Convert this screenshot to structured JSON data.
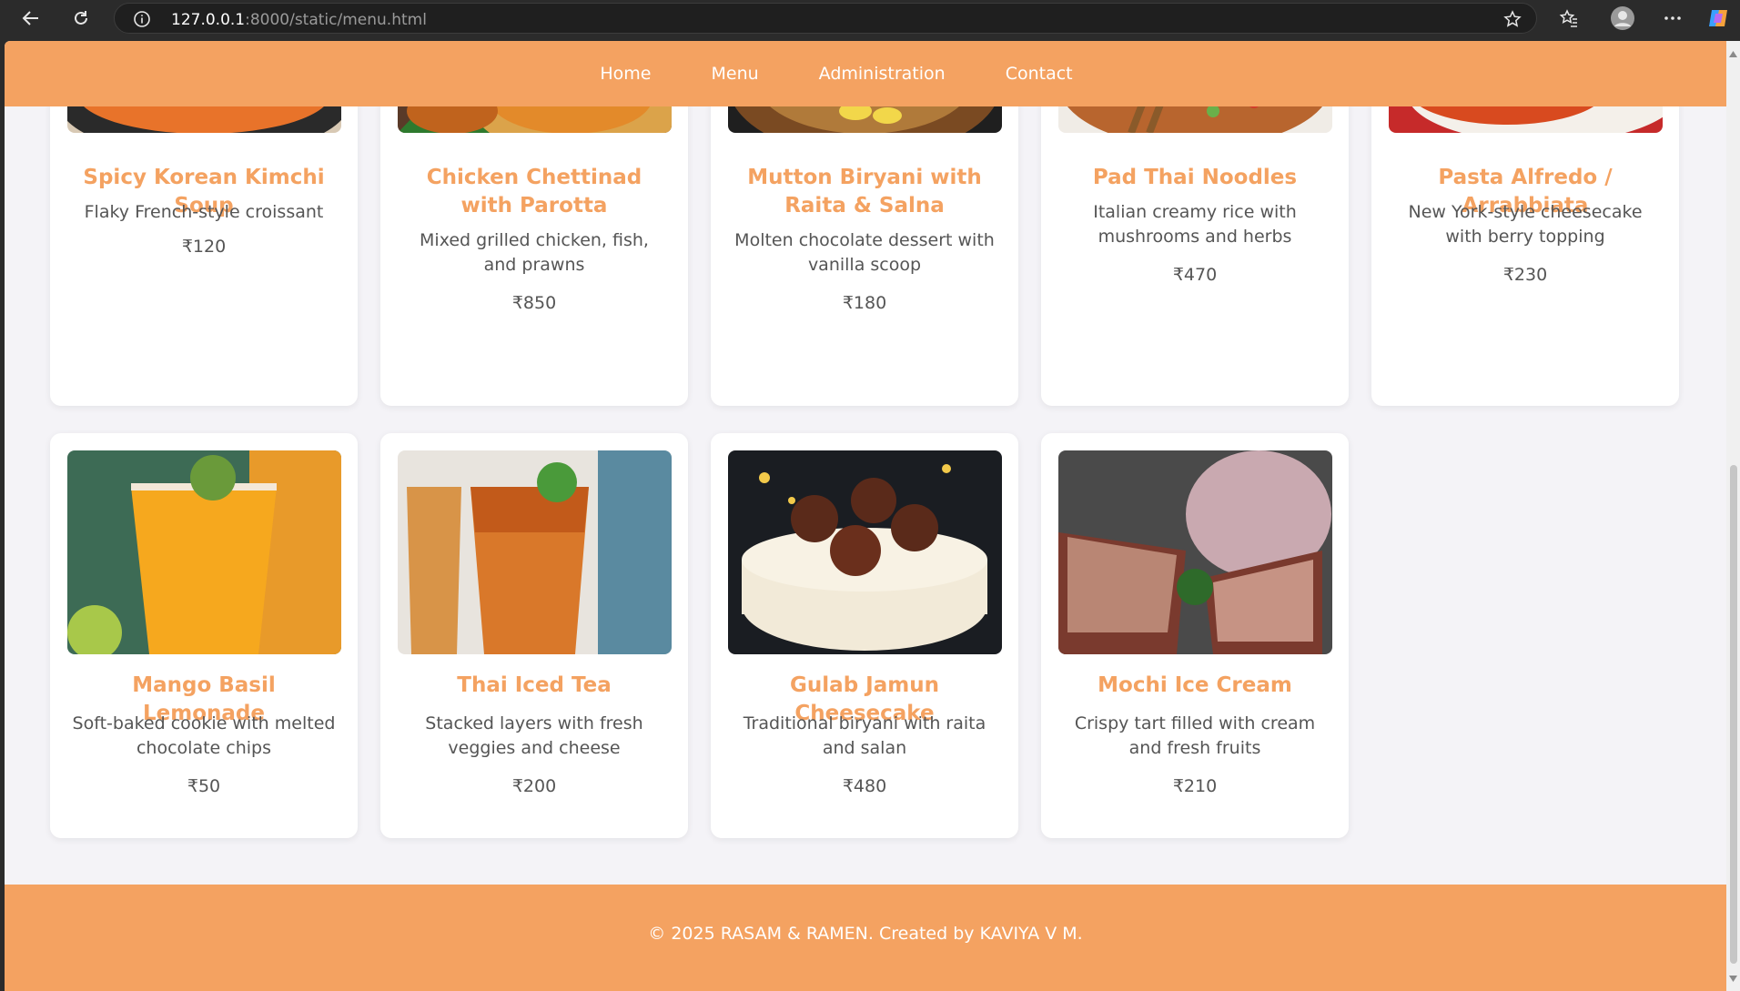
{
  "browser": {
    "url_host": "127.0.0.1",
    "url_rest": ":8000/static/menu.html"
  },
  "nav": {
    "items": [
      "Home",
      "Menu",
      "Administration",
      "Contact"
    ]
  },
  "menu_items": [
    {
      "title": "Spicy Korean Kimchi Soup",
      "desc": "Flaky French-style croissant",
      "price": "₹120"
    },
    {
      "title": "Chicken Chettinad with Parotta",
      "desc": "Mixed grilled chicken, fish, and prawns",
      "price": "₹850"
    },
    {
      "title": "Mutton Biryani with Raita & Salna",
      "desc": "Molten chocolate dessert with vanilla scoop",
      "price": "₹180"
    },
    {
      "title": "Pad Thai Noodles",
      "desc": "Italian creamy rice with mushrooms and herbs",
      "price": "₹470"
    },
    {
      "title": "Pasta Alfredo / Arrabbiata",
      "desc": "New York-style cheesecake with berry topping",
      "price": "₹230"
    },
    {
      "title": "Mango Basil Lemonade",
      "desc": "Soft-baked cookie with melted chocolate chips",
      "price": "₹50"
    },
    {
      "title": "Thai Iced Tea",
      "desc": "Stacked layers with fresh veggies and cheese",
      "price": "₹200"
    },
    {
      "title": "Gulab Jamun Cheesecake",
      "desc": "Traditional biryani with raita and salan",
      "price": "₹480"
    },
    {
      "title": "Mochi Ice Cream",
      "desc": "Crispy tart filled with cream and fresh fruits",
      "price": "₹210"
    }
  ],
  "footer": {
    "text": "© 2025 RASAM & RAMEN. Created by KAVIYA V M."
  },
  "colors": {
    "brand": "#f4a261",
    "background": "#f4f3f7"
  }
}
